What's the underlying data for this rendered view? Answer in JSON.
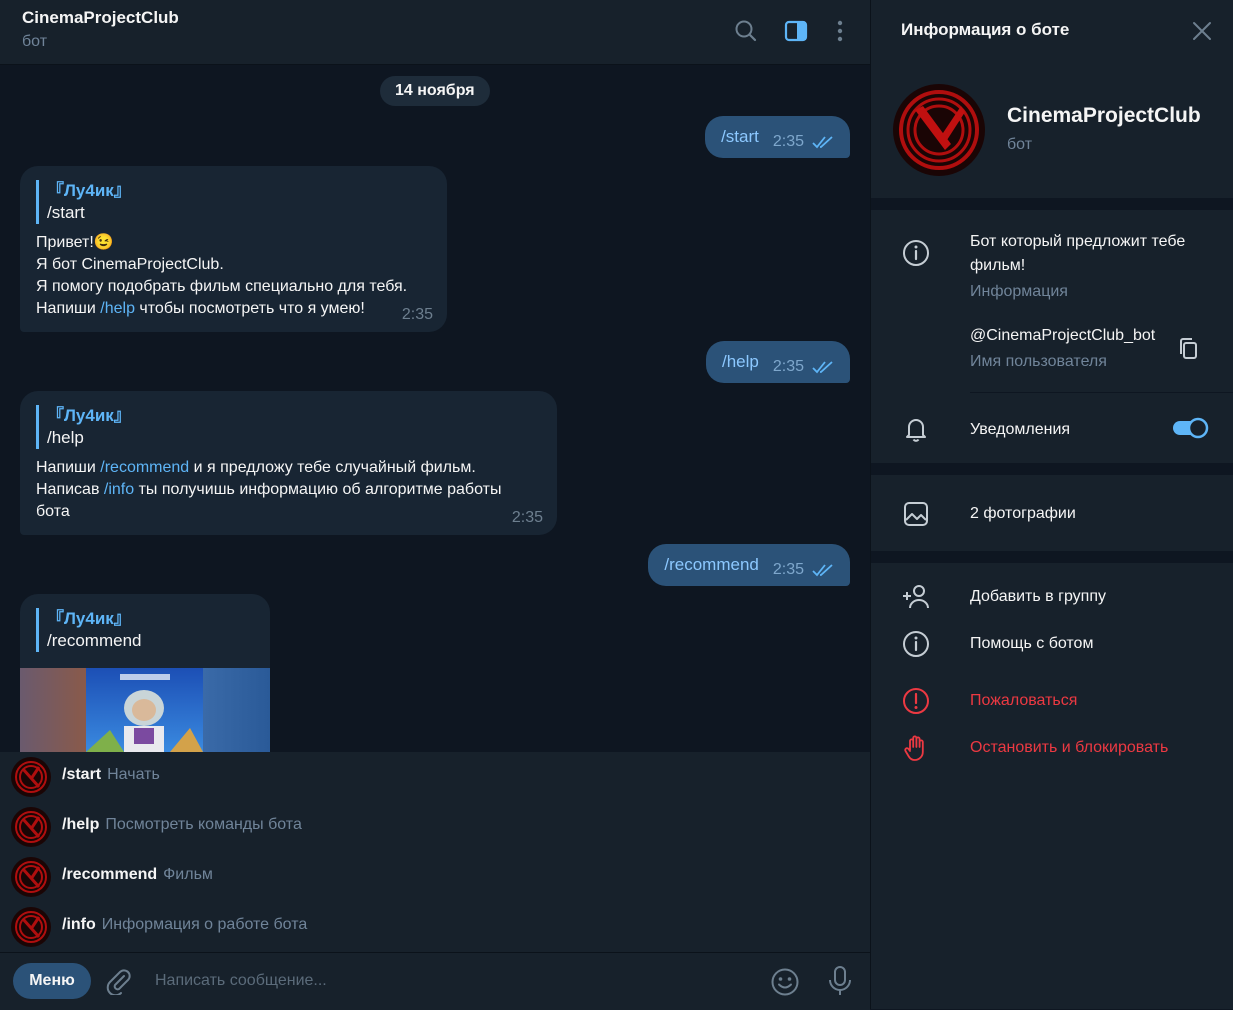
{
  "chat": {
    "title": "CinemaProjectClub",
    "subtitle": "бот",
    "date": "14 ноября",
    "messages": {
      "out1": {
        "text": "/start",
        "time": "2:35"
      },
      "in1": {
        "quote_name": "『Лу4ик』",
        "quote_text": "/start",
        "line1": "Привет!😉",
        "line2": "Я бот CinemaProjectClub.",
        "line3": "Я помогу подобрать фильм специально для тебя.",
        "line4_pre": "Напиши ",
        "line4_link": "/help",
        "line4_post": " чтобы посмотреть что я умею!",
        "time": "2:35"
      },
      "out2": {
        "text": "/help",
        "time": "2:35"
      },
      "in2": {
        "quote_name": "『Лу4ик』",
        "quote_text": "/help",
        "line1_pre": "Напиши ",
        "line1_link": "/recommend",
        "line1_post": " и я предложу тебе случайный фильм.",
        "line2_pre": "Написав ",
        "line2_link": "/info",
        "line2_post": " ты получишь информацию об алгоритме работы",
        "line3": "бота",
        "time": "2:35"
      },
      "out3": {
        "text": "/recommend",
        "time": "2:35"
      },
      "in3": {
        "quote_name": "『Лу4ик』",
        "quote_text": "/recommend"
      }
    },
    "commands": [
      {
        "name": "/start",
        "desc": "Начать"
      },
      {
        "name": "/help",
        "desc": "Посмотреть команды бота"
      },
      {
        "name": "/recommend",
        "desc": "Фильм"
      },
      {
        "name": "/info",
        "desc": "Информация о работе бота"
      }
    ],
    "input": {
      "menu_label": "Меню",
      "placeholder": "Написать сообщение..."
    }
  },
  "panel": {
    "title": "Информация о боте",
    "name": "CinemaProjectClub",
    "sub": "бот",
    "about_line1": "Бот который предложит тебе",
    "about_line2": "фильм!",
    "about_label": "Информация",
    "username": "@CinemaProjectClub_bot",
    "username_label": "Имя пользователя",
    "notifications": "Уведомления",
    "notifications_on": true,
    "photos": "2 фотографии",
    "add_to_group": "Добавить в группу",
    "help": "Помощь с ботом",
    "report": "Пожаловаться",
    "stop_block": "Остановить и блокировать"
  },
  "colors": {
    "background": "#0e1621",
    "surface": "#17212b",
    "outgoing": "#2b5278",
    "incoming": "#182533",
    "accent": "#5eb5f7",
    "danger": "#ec3942",
    "muted": "#708499"
  },
  "icons": [
    "search-icon",
    "sidebar-toggle-icon",
    "more-vertical-icon",
    "close-icon",
    "info-icon",
    "copy-icon",
    "bell-icon",
    "photo-icon",
    "add-user-icon",
    "help-icon",
    "report-icon",
    "stop-hand-icon",
    "attach-icon",
    "emoji-icon",
    "mic-icon",
    "double-check-icon"
  ]
}
